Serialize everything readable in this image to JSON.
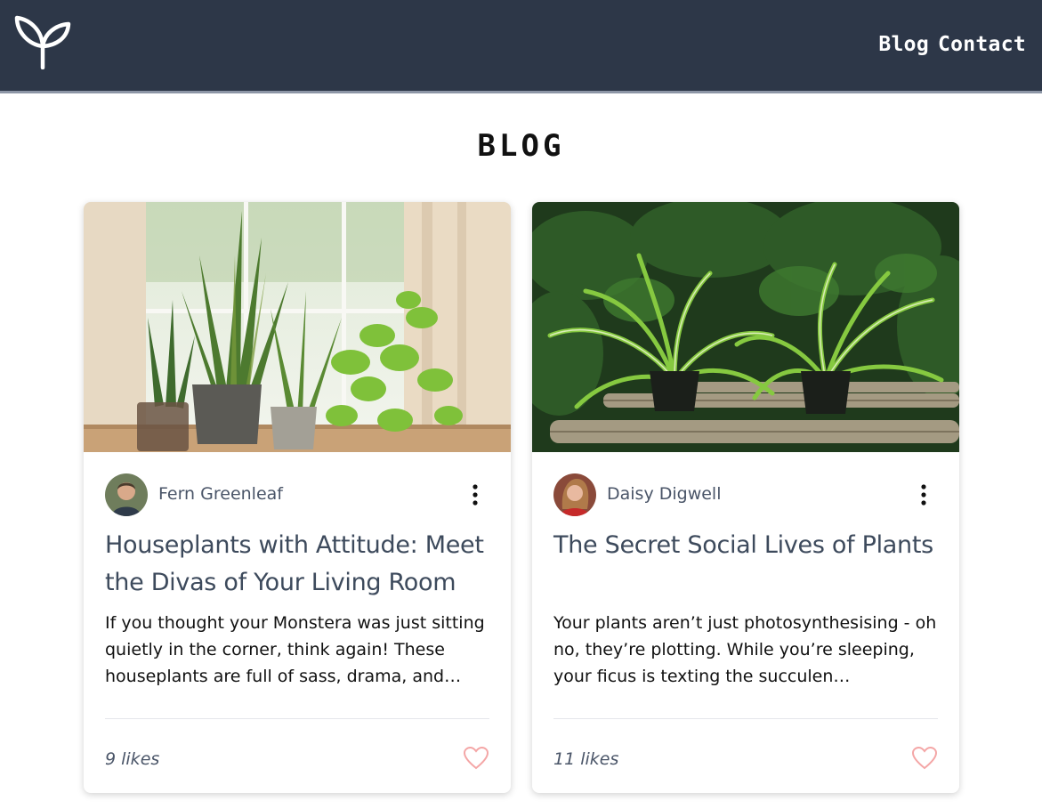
{
  "header": {
    "logo_icon": "sprout-icon",
    "nav": [
      {
        "label": "Blog"
      },
      {
        "label": "Contact"
      }
    ]
  },
  "page_title": "BLOG",
  "posts": [
    {
      "author": "Fern Greenleaf",
      "title": "Houseplants with Attitude: Meet the Divas of Your Living Room",
      "excerpt": "If you thought your Monstera was just sitting quietly in the corner, think again! These houseplants are full of sass, drama, and…",
      "likes": "9 likes",
      "image_icon": "houseplants-photo",
      "menu_icon": "more-vertical-icon",
      "like_icon": "heart-icon"
    },
    {
      "author": "Daisy Digwell",
      "title": "The Secret Social Lives of Plants",
      "excerpt": "Your plants aren’t just photosynthesising - oh no, they’re plotting. While you’re sleeping, your ficus is texting the succulen…",
      "likes": "11 likes",
      "image_icon": "spider-plants-photo",
      "menu_icon": "more-vertical-icon",
      "like_icon": "heart-icon"
    }
  ],
  "colors": {
    "header_bg": "#2d3748",
    "title_text": "#3d4a5c",
    "meta_text": "#4a5568",
    "heart": "#f4a6a6"
  }
}
